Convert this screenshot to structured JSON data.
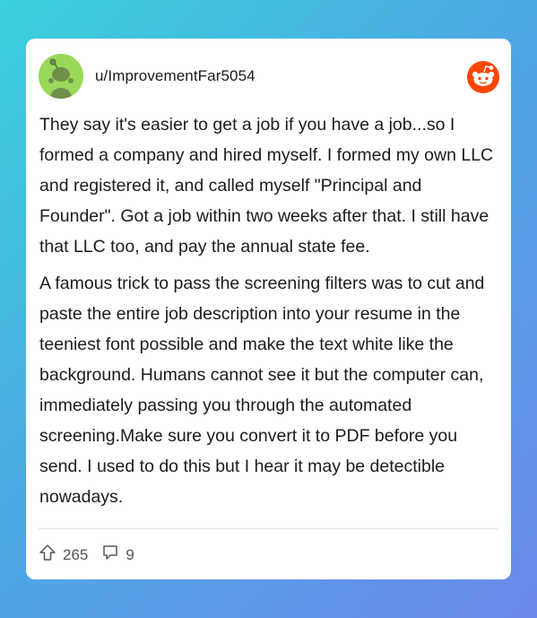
{
  "post": {
    "username": "u/ImprovementFar5054",
    "paragraphs": [
      "They say it's easier to get a job if you have a job...so I formed a company and hired myself. I formed my own LLC and registered it, and called myself \"Principal and Founder\". Got a job within two weeks after that. I still have that LLC too, and pay the annual state fee.",
      "A famous trick to pass the screening filters was to cut and paste the entire job description into your resume in the teeniest font possible and make the text white like the background. Humans cannot see it but the computer can, immediately passing you through the automated screening.Make sure you convert it to PDF before you send. I used to do this but I hear it may be detectible nowadays."
    ],
    "upvotes": "265",
    "comments": "9"
  },
  "icons": {
    "avatar": "snoo-avatar-icon",
    "logo": "reddit-logo-icon",
    "upvote": "upvote-arrow-icon",
    "comment": "comment-bubble-icon"
  },
  "colors": {
    "avatar_bg": "#9ad85a",
    "reddit_orange": "#ff4500",
    "background_start": "#3ad1dc",
    "background_end": "#6a88e8"
  }
}
